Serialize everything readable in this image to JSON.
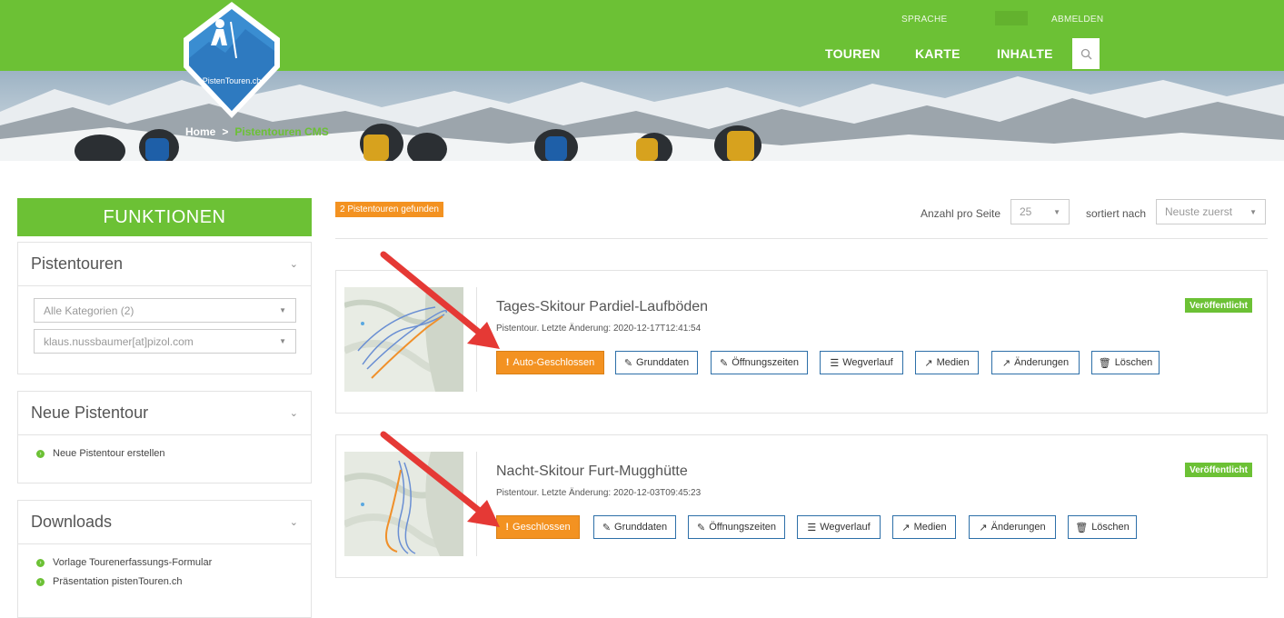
{
  "header": {
    "util_links": [
      "SPRACHE",
      "ABMELDEN"
    ],
    "nav": [
      "TOUREN",
      "KARTE",
      "INHALTE"
    ],
    "logo_text": "PistenTouren.ch",
    "breadcrumb": {
      "home": "Home",
      "separator": ">",
      "current": "Pistentouren CMS"
    }
  },
  "sidebar": {
    "title": "FUNKTIONEN",
    "pistentouren": {
      "heading": "Pistentouren",
      "category_select": "Alle Kategorien (2)",
      "user_select": "klaus.nussbaumer[at]pizol.com"
    },
    "neue": {
      "heading": "Neue Pistentour",
      "link": "Neue Pistentour erstellen"
    },
    "downloads": {
      "heading": "Downloads",
      "links": [
        "Vorlage Tourenerfassungs-Formular",
        "Präsentation pistenTouren.ch"
      ]
    }
  },
  "main": {
    "found_badge": "2 Pistentouren gefunden",
    "per_page_label": "Anzahl pro Seite",
    "per_page_value": "25",
    "sort_label": "sortiert nach",
    "sort_value": "Neuste zuerst",
    "cards": [
      {
        "title": "Tages-Skitour Pardiel-Laufböden",
        "meta": "Pistentour. Letzte Änderung: 2020-12-17T12:41:54",
        "status": "Veröffentlicht",
        "buttons": [
          "Auto-Geschlossen",
          "Grunddaten",
          "Öffnungszeiten",
          "Wegverlauf",
          "Medien",
          "Änderungen",
          "Löschen"
        ]
      },
      {
        "title": "Nacht-Skitour Furt-Mugghütte",
        "meta": "Pistentour. Letzte Änderung: 2020-12-03T09:45:23",
        "status": "Veröffentlicht",
        "buttons": [
          "Geschlossen",
          "Grunddaten",
          "Öffnungszeiten",
          "Wegverlauf",
          "Medien",
          "Änderungen",
          "Löschen"
        ]
      }
    ]
  },
  "colors": {
    "brand_green": "#6cc135",
    "warning_orange": "#f39221",
    "button_border": "#2d6fa8",
    "annotation_red": "#e53935"
  }
}
